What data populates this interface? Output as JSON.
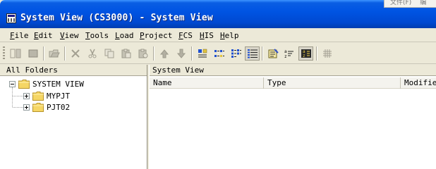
{
  "window": {
    "title": "System View (CS3000) - System View"
  },
  "background_window": {
    "menu_items": [
      "文件(F)",
      "编"
    ]
  },
  "menubar": {
    "items": [
      {
        "label": "File",
        "key": "file"
      },
      {
        "label": "Edit",
        "key": "edit"
      },
      {
        "label": "View",
        "key": "view"
      },
      {
        "label": "Tools",
        "key": "tools"
      },
      {
        "label": "Load",
        "key": "load"
      },
      {
        "label": "Project",
        "key": "project"
      },
      {
        "label": "FCS",
        "key": "fcs"
      },
      {
        "label": "HIS",
        "key": "his"
      },
      {
        "label": "Help",
        "key": "help"
      }
    ]
  },
  "toolbar": {
    "buttons": [
      {
        "icon": "dual-window-icon",
        "enabled": false
      },
      {
        "icon": "stop-icon",
        "enabled": false
      },
      {
        "icon": "open-folder-icon",
        "enabled": false
      },
      {
        "icon": "delete-icon",
        "enabled": false
      },
      {
        "icon": "cut-icon",
        "enabled": false
      },
      {
        "icon": "copy-icon",
        "enabled": false
      },
      {
        "icon": "paste-icon",
        "enabled": false
      },
      {
        "icon": "paste-special-icon",
        "enabled": false
      },
      {
        "icon": "move-up-icon",
        "enabled": false
      },
      {
        "icon": "move-down-icon",
        "enabled": false
      },
      {
        "icon": "large-icons-view-icon",
        "enabled": true
      },
      {
        "icon": "small-icons-view-icon",
        "enabled": true
      },
      {
        "icon": "list-view-icon",
        "enabled": true
      },
      {
        "icon": "details-view-icon",
        "enabled": true,
        "active": true
      },
      {
        "icon": "properties-icon",
        "enabled": true
      },
      {
        "icon": "sort-ascending-icon",
        "enabled": true
      },
      {
        "icon": "sort-descending-icon",
        "enabled": true
      },
      {
        "icon": "grid-icon",
        "enabled": false
      }
    ]
  },
  "left_pane": {
    "header": "All Folders",
    "tree": {
      "root": {
        "label": "SYSTEM VIEW",
        "expanded": true
      },
      "children": [
        {
          "label": "MYPJT",
          "expanded": false
        },
        {
          "label": "PJT02",
          "expanded": false
        }
      ]
    }
  },
  "right_pane": {
    "header": "System View",
    "columns": [
      "Name",
      "Type",
      "Modified"
    ]
  },
  "colors": {
    "titlebar": "#0054e3",
    "chrome": "#ece9d8",
    "folder": "#f5d665"
  }
}
